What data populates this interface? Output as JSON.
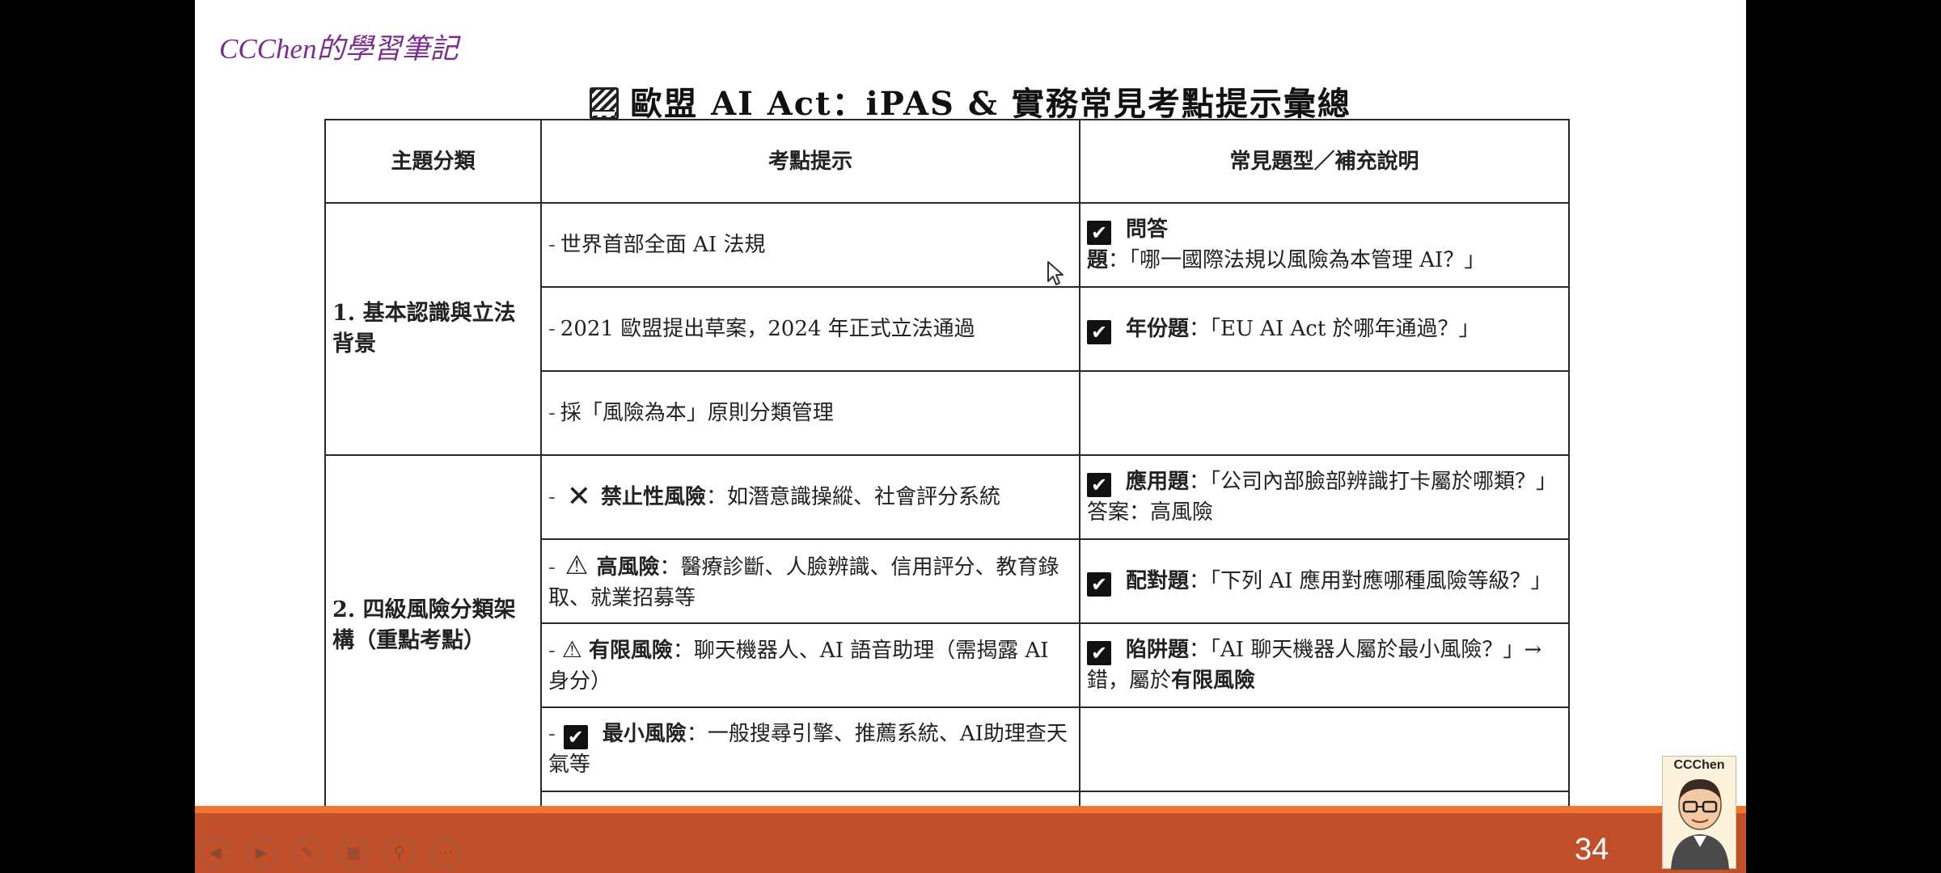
{
  "header": {
    "logo": "CCChen的學習筆記",
    "title": "歐盟 AI Act：iPAS & 實務常見考點提示彙總"
  },
  "table": {
    "headers": [
      "主題分類",
      "考點提示",
      "常見題型／補充說明"
    ],
    "sections": [
      {
        "category": "1. 基本認識與立法背景",
        "rows": [
          {
            "point": "世界首部全面 AI 法規",
            "note_type": "問答題",
            "note_text": "：「哪一國際法規以風險為本管理 AI？」"
          },
          {
            "point": "2021 歐盟提出草案，2024 年正式立法通過",
            "note_type": "年份題",
            "note_text": "：「EU AI Act 於哪年通過？」"
          },
          {
            "point": "採「風險為本」原則分類管理",
            "note_type": "",
            "note_text": ""
          }
        ]
      },
      {
        "category": "2. 四級風險分類架構（重點考點）",
        "rows": [
          {
            "icon": "x-icon",
            "label": "禁止性風險",
            "desc": "：如潛意識操縱、社會評分系統",
            "note_type": "應用題",
            "note_text": "：「公司內部臉部辨識打卡屬於哪類？」答案：高風險"
          },
          {
            "icon": "warning-icon",
            "label": "高風險",
            "desc": "：醫療診斷、人臉辨識、信用評分、教育錄取、就業招募等",
            "note_type": "配對題",
            "note_text": "：「下列 AI 應用對應哪種風險等級？」"
          },
          {
            "icon": "warning-small-icon",
            "label": "有限風險",
            "desc": "：聊天機器人、AI 語音助理（需揭露 AI 身分）",
            "note_type": "陷阱題",
            "note_text": "：「AI 聊天機器人屬於最小風險？」→ 錯，屬於",
            "note_bold_tail": "有限風險"
          },
          {
            "icon": "checkbox-icon",
            "label": "最小風險",
            "desc": "：一般搜尋引擎、推薦系統、AI助理查天氣等",
            "note_type": "",
            "note_text": ""
          }
        ]
      }
    ]
  },
  "footer": {
    "page_number": "34",
    "avatar_name": "CCChen",
    "controls": [
      "previous-icon",
      "next-icon",
      "pen-icon",
      "slides-grid-icon",
      "zoom-icon",
      "more-icon"
    ]
  },
  "colors": {
    "logo": "#7a2f8f",
    "bar": "#c1502a",
    "bar_top": "#f0762d",
    "background": "#000000"
  }
}
